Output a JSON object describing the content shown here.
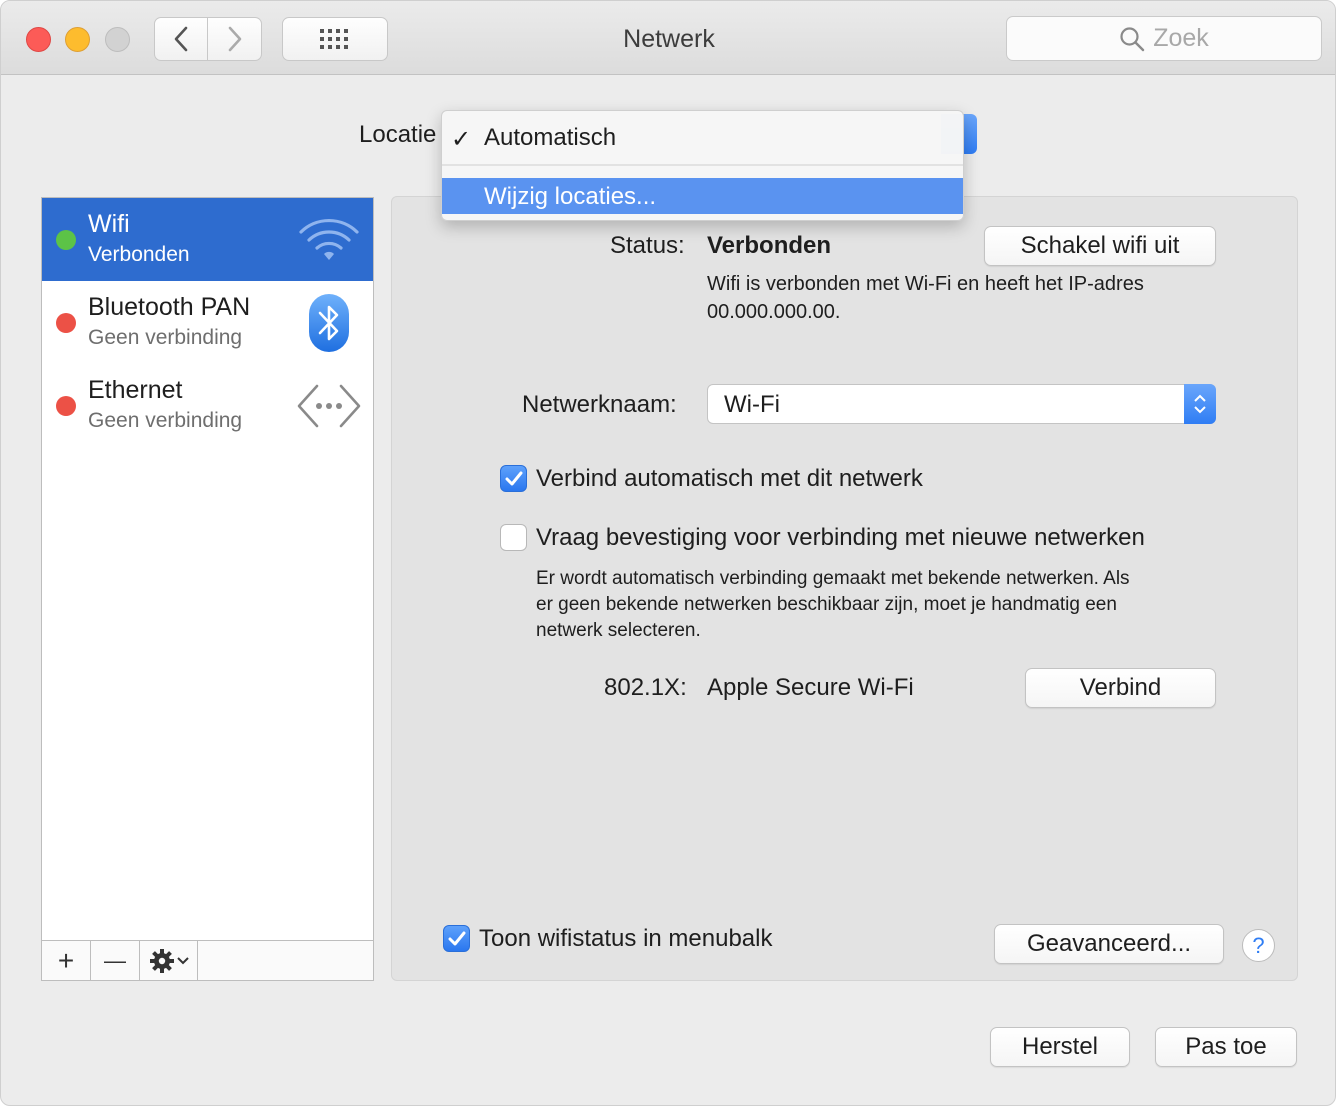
{
  "window": {
    "title": "Netwerk"
  },
  "search": {
    "placeholder": "Zoek"
  },
  "location": {
    "label": "Locatie",
    "menu": {
      "items": [
        {
          "label": "Automatisch",
          "checked": true
        },
        {
          "label": "Wijzig locaties...",
          "highlighted": true
        }
      ]
    }
  },
  "services": [
    {
      "name": "Wifi",
      "status": "Verbonden",
      "status_color": "#5cc347",
      "icon": "wifi-icon",
      "selected": true
    },
    {
      "name": "Bluetooth PAN",
      "status": "Geen verbinding",
      "status_color": "#ec5146",
      "icon": "bluetooth-icon",
      "selected": false
    },
    {
      "name": "Ethernet",
      "status": "Geen verbinding",
      "status_color": "#ec5146",
      "icon": "ethernet-icon",
      "selected": false
    }
  ],
  "sidebar_toolbar": {
    "add": "+",
    "remove": "—"
  },
  "detail": {
    "status_label": "Status:",
    "status_value": "Verbonden",
    "toggle_wifi_button": "Schakel wifi uit",
    "status_description_line1": "Wifi is verbonden met Wi-Fi en heeft het IP-adres",
    "status_description_line2": "00.000.000.00.",
    "network_name_label": "Netwerknaam:",
    "network_name_value": "Wi-Fi",
    "auto_join_label": "Verbind automatisch met dit netwerk",
    "auto_join_checked": true,
    "ask_join_label": "Vraag bevestiging voor verbinding met nieuwe netwerken",
    "ask_join_checked": false,
    "ask_join_desc_line1": "Er wordt automatisch verbinding gemaakt met bekende netwerken. Als",
    "ask_join_desc_line2": "er geen bekende netwerken beschikbaar zijn, moet je handmatig een",
    "ask_join_desc_line3": "netwerk selecteren.",
    "dot1x_label": "802.1X:",
    "dot1x_value": "Apple Secure Wi-Fi",
    "connect_button": "Verbind",
    "show_status_label": "Toon wifistatus in menubalk",
    "show_status_checked": true,
    "advanced_button": "Geavanceerd...",
    "help_button": "?"
  },
  "footer": {
    "revert_button": "Herstel",
    "apply_button": "Pas toe"
  },
  "colors": {
    "accent": "#2f7df4",
    "selection": "#2e6ccf",
    "menu_highlight": "#5a93f0"
  }
}
